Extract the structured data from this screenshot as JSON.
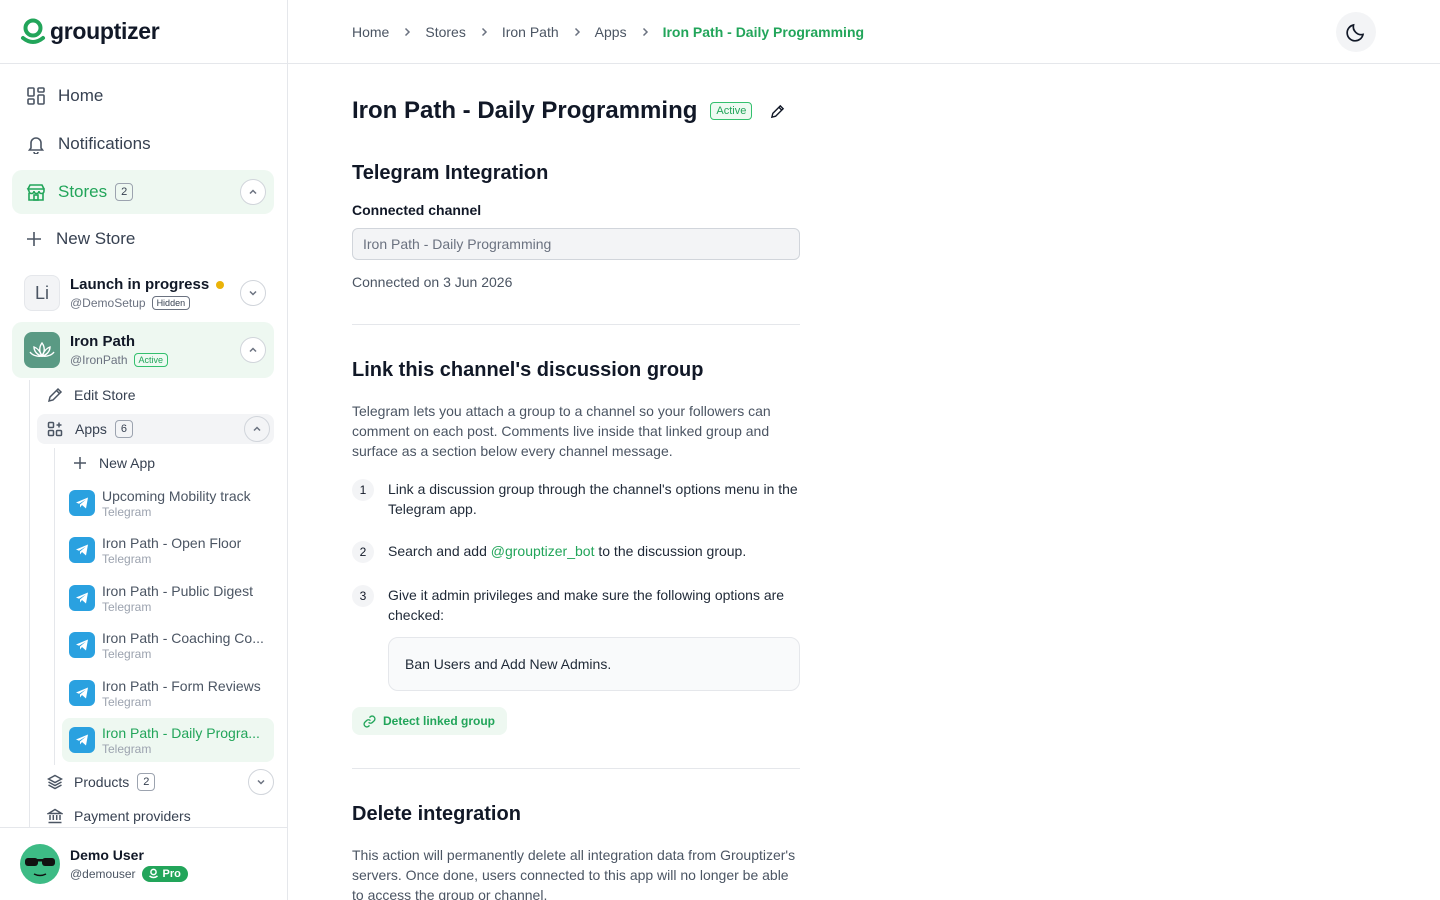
{
  "brand": {
    "name": "grouptizer"
  },
  "sidebar": {
    "home_label": "Home",
    "notifications_label": "Notifications",
    "stores_label": "Stores",
    "stores_count": "2",
    "new_store_label": "New Store",
    "stores": [
      {
        "initials": "Li",
        "name": "Launch in progress",
        "handle": "@DemoSetup",
        "badge": "Hidden"
      },
      {
        "name": "Iron Path",
        "handle": "@IronPath",
        "badge": "Active"
      }
    ],
    "edit_store_label": "Edit Store",
    "apps_label": "Apps",
    "apps_count": "6",
    "new_app_label": "New App",
    "apps": [
      {
        "name": "Upcoming Mobility track",
        "type": "Telegram"
      },
      {
        "name": "Iron Path - Open Floor",
        "type": "Telegram"
      },
      {
        "name": "Iron Path - Public Digest",
        "type": "Telegram"
      },
      {
        "name": "Iron Path - Coaching Co...",
        "type": "Telegram"
      },
      {
        "name": "Iron Path - Form Reviews",
        "type": "Telegram"
      },
      {
        "name": "Iron Path - Daily Progra...",
        "type": "Telegram"
      }
    ],
    "products_label": "Products",
    "products_count": "2",
    "payment_providers_label": "Payment providers"
  },
  "user": {
    "name": "Demo User",
    "handle": "@demouser",
    "plan": "Pro"
  },
  "breadcrumb": [
    "Home",
    "Stores",
    "Iron Path",
    "Apps",
    "Iron Path - Daily Programming"
  ],
  "page": {
    "title": "Iron Path - Daily Programming",
    "status": "Active"
  },
  "telegram": {
    "section_title": "Telegram Integration",
    "field_label": "Connected channel",
    "channel_value": "Iron Path - Daily Programming",
    "connected_on": "Connected on 3 Jun 2026"
  },
  "link_group": {
    "title": "Link this channel's discussion group",
    "description": "Telegram lets you attach a group to a channel so your followers can comment on each post. Comments live inside that linked group and surface as a section below every channel message.",
    "steps": [
      {
        "num": "1",
        "text": "Link a discussion group through the channel's options menu in the Telegram app."
      },
      {
        "num": "2",
        "before": "Search and add ",
        "bot": "@grouptizer_bot",
        "after": " to the discussion group."
      },
      {
        "num": "3",
        "text": "Give it admin privileges and make sure the following options are checked:"
      }
    ],
    "options_text": "Ban Users and Add New Admins.",
    "detect_label": "Detect linked group"
  },
  "delete": {
    "title": "Delete integration",
    "description": "This action will permanently delete all integration data from Grouptizer's servers. Once done, users connected to this app will no longer be able to access the group or channel."
  },
  "colors": {
    "accent": "#22a55a",
    "accent_bg": "#eef8f1",
    "telegram": "#2aa1e0"
  },
  "icons": {
    "home": "dashboard-icon",
    "notifications": "bell-icon",
    "stores": "store-icon",
    "new_store": "plus-icon",
    "edit": "pencil-icon",
    "apps": "apps-icon",
    "app": "telegram-icon",
    "products": "layers-icon",
    "payment": "bank-icon",
    "theme": "moon-icon",
    "link": "link-icon"
  }
}
